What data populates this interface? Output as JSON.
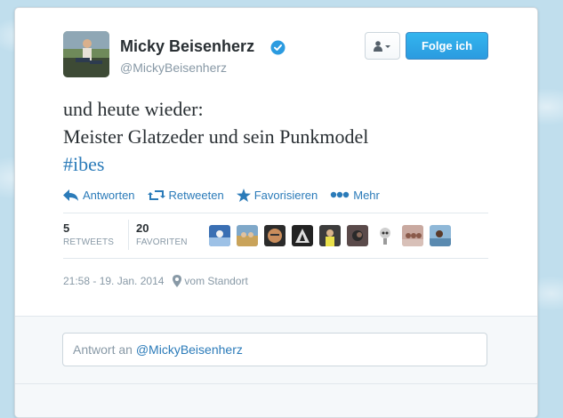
{
  "user": {
    "display_name": "Micky Beisenherz",
    "handle": "@MickyBeisenherz",
    "verified_icon": "verified-badge-icon"
  },
  "header": {
    "user_actions_icon": "person-dropdown-icon",
    "follow_label": "Folge ich"
  },
  "tweet": {
    "lines": [
      "und heute wieder:",
      "Meister Glatzeder und sein Punkmodel"
    ],
    "hashtag": "#ibes"
  },
  "actions": [
    {
      "icon": "reply-arrow-icon",
      "label": "Antworten"
    },
    {
      "icon": "retweet-icon",
      "label": "Retweeten"
    },
    {
      "icon": "star-icon",
      "label": "Favorisieren"
    },
    {
      "icon": "more-dots-icon",
      "label": "Mehr"
    }
  ],
  "stats": {
    "retweets_count": "5",
    "retweets_label": "RETWEETS",
    "favorites_count": "20",
    "favorites_label": "FAVORITEN"
  },
  "favorited_by_avatar_count": 9,
  "meta": {
    "timestamp": "21:58 - 19. Jan. 2014",
    "location_icon": "map-pin-icon",
    "location_label": "vom Standort"
  },
  "reply": {
    "prefix": "Antwort an ",
    "mention": "@MickyBeisenherz"
  },
  "colors": {
    "accent": "#2b7bb9",
    "follow_button": "#2b9be0",
    "background": "#c0deed",
    "muted_text": "#8899a6"
  }
}
